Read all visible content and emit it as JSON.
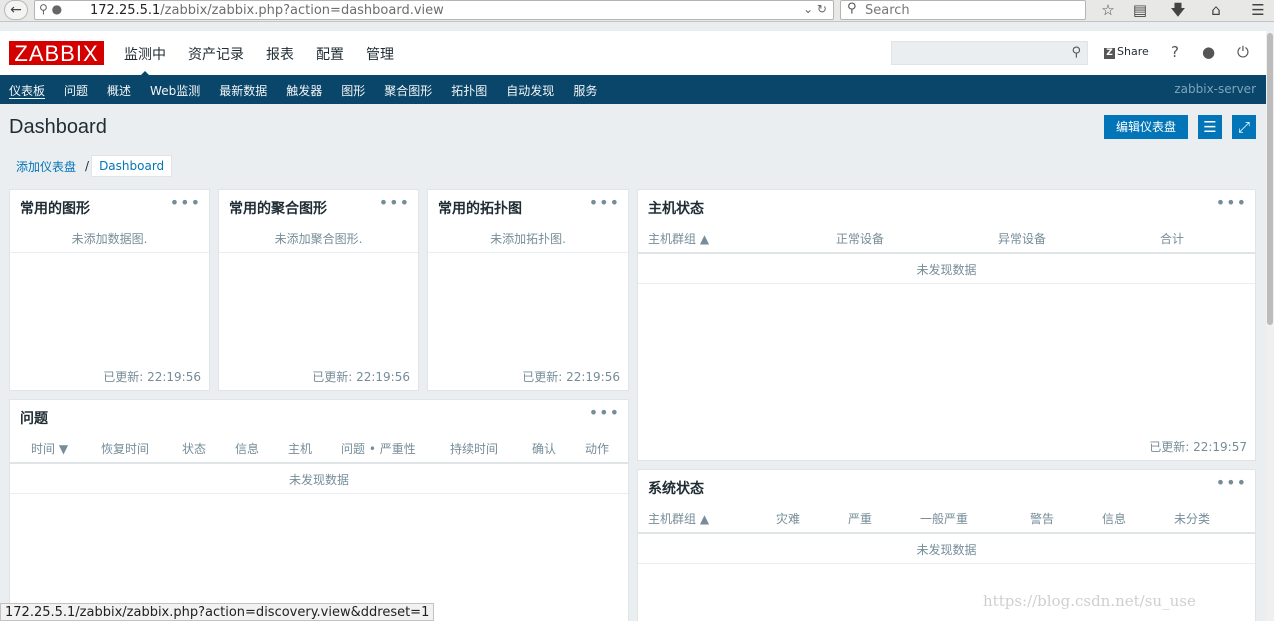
{
  "browser": {
    "url_host": "172.25.5.1",
    "url_path": "/zabbix/zabbix.php?action=dashboard.view",
    "search_placeholder": "Search",
    "status_link": "172.25.5.1/zabbix/zabbix.php?action=discovery.view&ddreset=1"
  },
  "header": {
    "logo": "ZABBIX",
    "menu": [
      "监测中",
      "资产记录",
      "报表",
      "配置",
      "管理"
    ],
    "share_label": "Share",
    "help_label": "?"
  },
  "subnav": {
    "items": [
      "仪表板",
      "问题",
      "概述",
      "Web监测",
      "最新数据",
      "触发器",
      "图形",
      "聚合图形",
      "拓扑图",
      "自动发现",
      "服务"
    ],
    "server": "zabbix-server"
  },
  "page": {
    "title": "Dashboard",
    "edit_button": "编辑仪表盘",
    "breadcrumb": [
      "添加仪表盘",
      "Dashboard"
    ],
    "breadcrumb_sep": "/"
  },
  "widgets": {
    "fav_graphs": {
      "title": "常用的图形",
      "message": "未添加数据图.",
      "updated": "已更新: 22:19:56"
    },
    "fav_screens": {
      "title": "常用的聚合图形",
      "message": "未添加聚合图形.",
      "updated": "已更新: 22:19:56"
    },
    "fav_maps": {
      "title": "常用的拓扑图",
      "message": "未添加拓扑图.",
      "updated": "已更新: 22:19:56"
    },
    "host_status": {
      "title": "主机状态",
      "columns": [
        "主机群组 ▲",
        "正常设备",
        "异常设备",
        "合计"
      ],
      "nodata": "未发现数据",
      "updated": "已更新: 22:19:57"
    },
    "problems": {
      "title": "问题",
      "columns": [
        "时间 ▼",
        "恢复时间",
        "状态",
        "信息",
        "主机",
        "问题 • 严重性",
        "持续时间",
        "确认",
        "动作"
      ],
      "nodata": "未发现数据"
    },
    "system_status": {
      "title": "系统状态",
      "columns": [
        "主机群组 ▲",
        "灾难",
        "严重",
        "一般严重",
        "警告",
        "信息",
        "未分类"
      ],
      "nodata": "未发现数据"
    }
  },
  "watermark": "https://blog.csdn.net/su_use",
  "colors": {
    "brand_red": "#d40000",
    "nav_blue": "#0a466a",
    "button_blue": "#0275b8"
  }
}
